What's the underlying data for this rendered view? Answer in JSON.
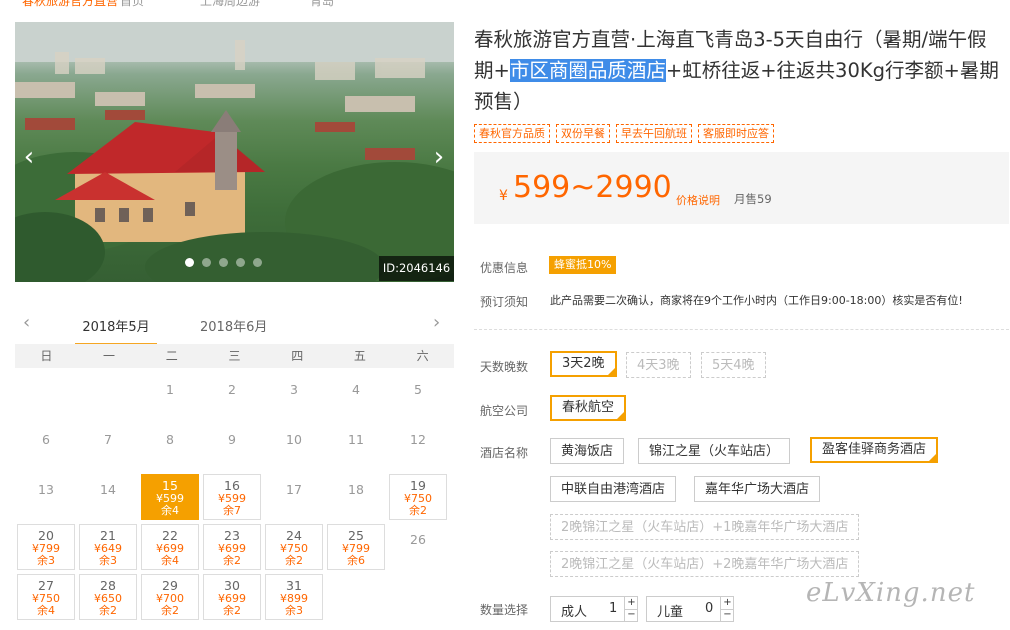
{
  "top_cut": {
    "a": "春秋旅游官方直营",
    "b": "首页",
    "c": "上海周边游",
    "d": "青岛"
  },
  "gallery": {
    "id_label": "ID:2046146",
    "dots": 5,
    "active_dot": 0
  },
  "calendar": {
    "month1": "2018年5月",
    "month2": "2018年6月",
    "weekdays": [
      "日",
      "一",
      "二",
      "三",
      "四",
      "五",
      "六"
    ],
    "cells": [
      {
        "d": ""
      },
      {
        "d": ""
      },
      {
        "d": "1"
      },
      {
        "d": "2"
      },
      {
        "d": "3"
      },
      {
        "d": "4"
      },
      {
        "d": "5"
      },
      {
        "d": "6"
      },
      {
        "d": "7"
      },
      {
        "d": "8"
      },
      {
        "d": "9"
      },
      {
        "d": "10"
      },
      {
        "d": "11"
      },
      {
        "d": "12"
      },
      {
        "d": "13"
      },
      {
        "d": "14"
      },
      {
        "d": "15",
        "p": "¥599",
        "r": "余4",
        "sel": true
      },
      {
        "d": "16",
        "p": "¥599",
        "r": "余7"
      },
      {
        "d": "17"
      },
      {
        "d": "18"
      },
      {
        "d": "19",
        "p": "¥750",
        "r": "余2"
      },
      {
        "d": "20",
        "p": "¥799",
        "r": "余3"
      },
      {
        "d": "21",
        "p": "¥649",
        "r": "余3"
      },
      {
        "d": "22",
        "p": "¥699",
        "r": "余4"
      },
      {
        "d": "23",
        "p": "¥699",
        "r": "余2"
      },
      {
        "d": "24",
        "p": "¥750",
        "r": "余2"
      },
      {
        "d": "25",
        "p": "¥799",
        "r": "余6"
      },
      {
        "d": "26"
      },
      {
        "d": "27",
        "p": "¥750",
        "r": "余4"
      },
      {
        "d": "28",
        "p": "¥650",
        "r": "余2"
      },
      {
        "d": "29",
        "p": "¥700",
        "r": "余2"
      },
      {
        "d": "30",
        "p": "¥699",
        "r": "余2"
      },
      {
        "d": "31",
        "p": "¥899",
        "r": "余3"
      }
    ]
  },
  "product": {
    "title_a": "春秋旅游官方直营·上海直飞青岛3-5天自由行（暑期/端午假期+",
    "title_hl": "市区商圈品质酒店",
    "title_b": "+虹桥往返+往返共30Kg行李额+暑期预售）",
    "tags": [
      "春秋官方品质",
      "双份早餐",
      "早去午回航班",
      "客服即时应答"
    ],
    "price_symbol": "¥",
    "price": "599~2990",
    "price_explain": "价格说明",
    "sold": "月售59"
  },
  "info": {
    "promo_label": "优惠信息",
    "promo_badge": "蜂蜜抵10%",
    "notice_label": "预订须知",
    "notice_text": "此产品需要二次确认，商家将在9个工作小时内（工作日9:00-18:00）核实是否有位!"
  },
  "options": {
    "days_label": "天数晚数",
    "days": [
      "3天2晚",
      "4天3晚",
      "5天4晚"
    ],
    "airline_label": "航空公司",
    "airline": "春秋航空",
    "hotel_label": "酒店名称",
    "hotels": [
      "黄海饭店",
      "锦江之星（火车站店）",
      "盈客佳驿商务酒店",
      "中联自由港湾酒店",
      "嘉年华广场大酒店"
    ],
    "combo1": "2晚锦江之星（火车站店）+1晚嘉年华广场大酒店",
    "combo2": "2晚锦江之星（火车站店）+2晚嘉年华广场大酒店",
    "qty_label": "数量选择",
    "adult_label": "成人",
    "adult_val": "1",
    "child_label": "儿童",
    "child_val": "0",
    "plus": "+",
    "minus": "−"
  },
  "watermark": "eLvXing.net",
  "colors": {
    "accent": "#f5a000",
    "price": "#ff6600",
    "highlight": "#3f8ce8"
  }
}
